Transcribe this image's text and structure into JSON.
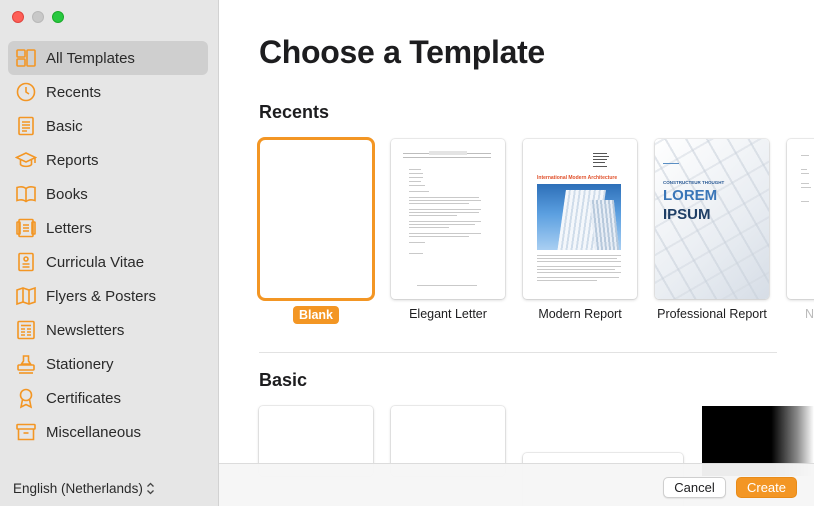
{
  "window": {
    "controls": [
      "close",
      "minimize",
      "zoom"
    ]
  },
  "sidebar": {
    "items": [
      {
        "label": "All Templates",
        "icon": "grid-icon",
        "selected": true
      },
      {
        "label": "Recents",
        "icon": "clock-icon"
      },
      {
        "label": "Basic",
        "icon": "document-icon"
      },
      {
        "label": "Reports",
        "icon": "graduation-cap-icon"
      },
      {
        "label": "Books",
        "icon": "book-icon"
      },
      {
        "label": "Letters",
        "icon": "letter-icon"
      },
      {
        "label": "Curricula Vitae",
        "icon": "cv-icon"
      },
      {
        "label": "Flyers & Posters",
        "icon": "map-icon"
      },
      {
        "label": "Newsletters",
        "icon": "newsletter-icon"
      },
      {
        "label": "Stationery",
        "icon": "stamp-icon"
      },
      {
        "label": "Certificates",
        "icon": "ribbon-icon"
      },
      {
        "label": "Miscellaneous",
        "icon": "archive-box-icon"
      }
    ],
    "language": "English (Netherlands)"
  },
  "main": {
    "title": "Choose a Template",
    "sections": {
      "recents": "Recents",
      "basic": "Basic"
    },
    "recents": [
      {
        "label": "Blank",
        "selected": true
      },
      {
        "label": "Elegant Letter"
      },
      {
        "label": "Modern Report",
        "heading": "International Modern Architecture"
      },
      {
        "label": "Professional Report",
        "eyebrow": "CONSTRUCTEUR THOUGHT",
        "big1": "LOREM",
        "big2": "IPSUM"
      },
      {
        "label": "N"
      }
    ]
  },
  "footer": {
    "cancel": "Cancel",
    "create": "Create"
  },
  "colors": {
    "accent": "#f39624",
    "sidebar_bg": "#e6e6e6",
    "selected_row": "#cfcfcf"
  }
}
